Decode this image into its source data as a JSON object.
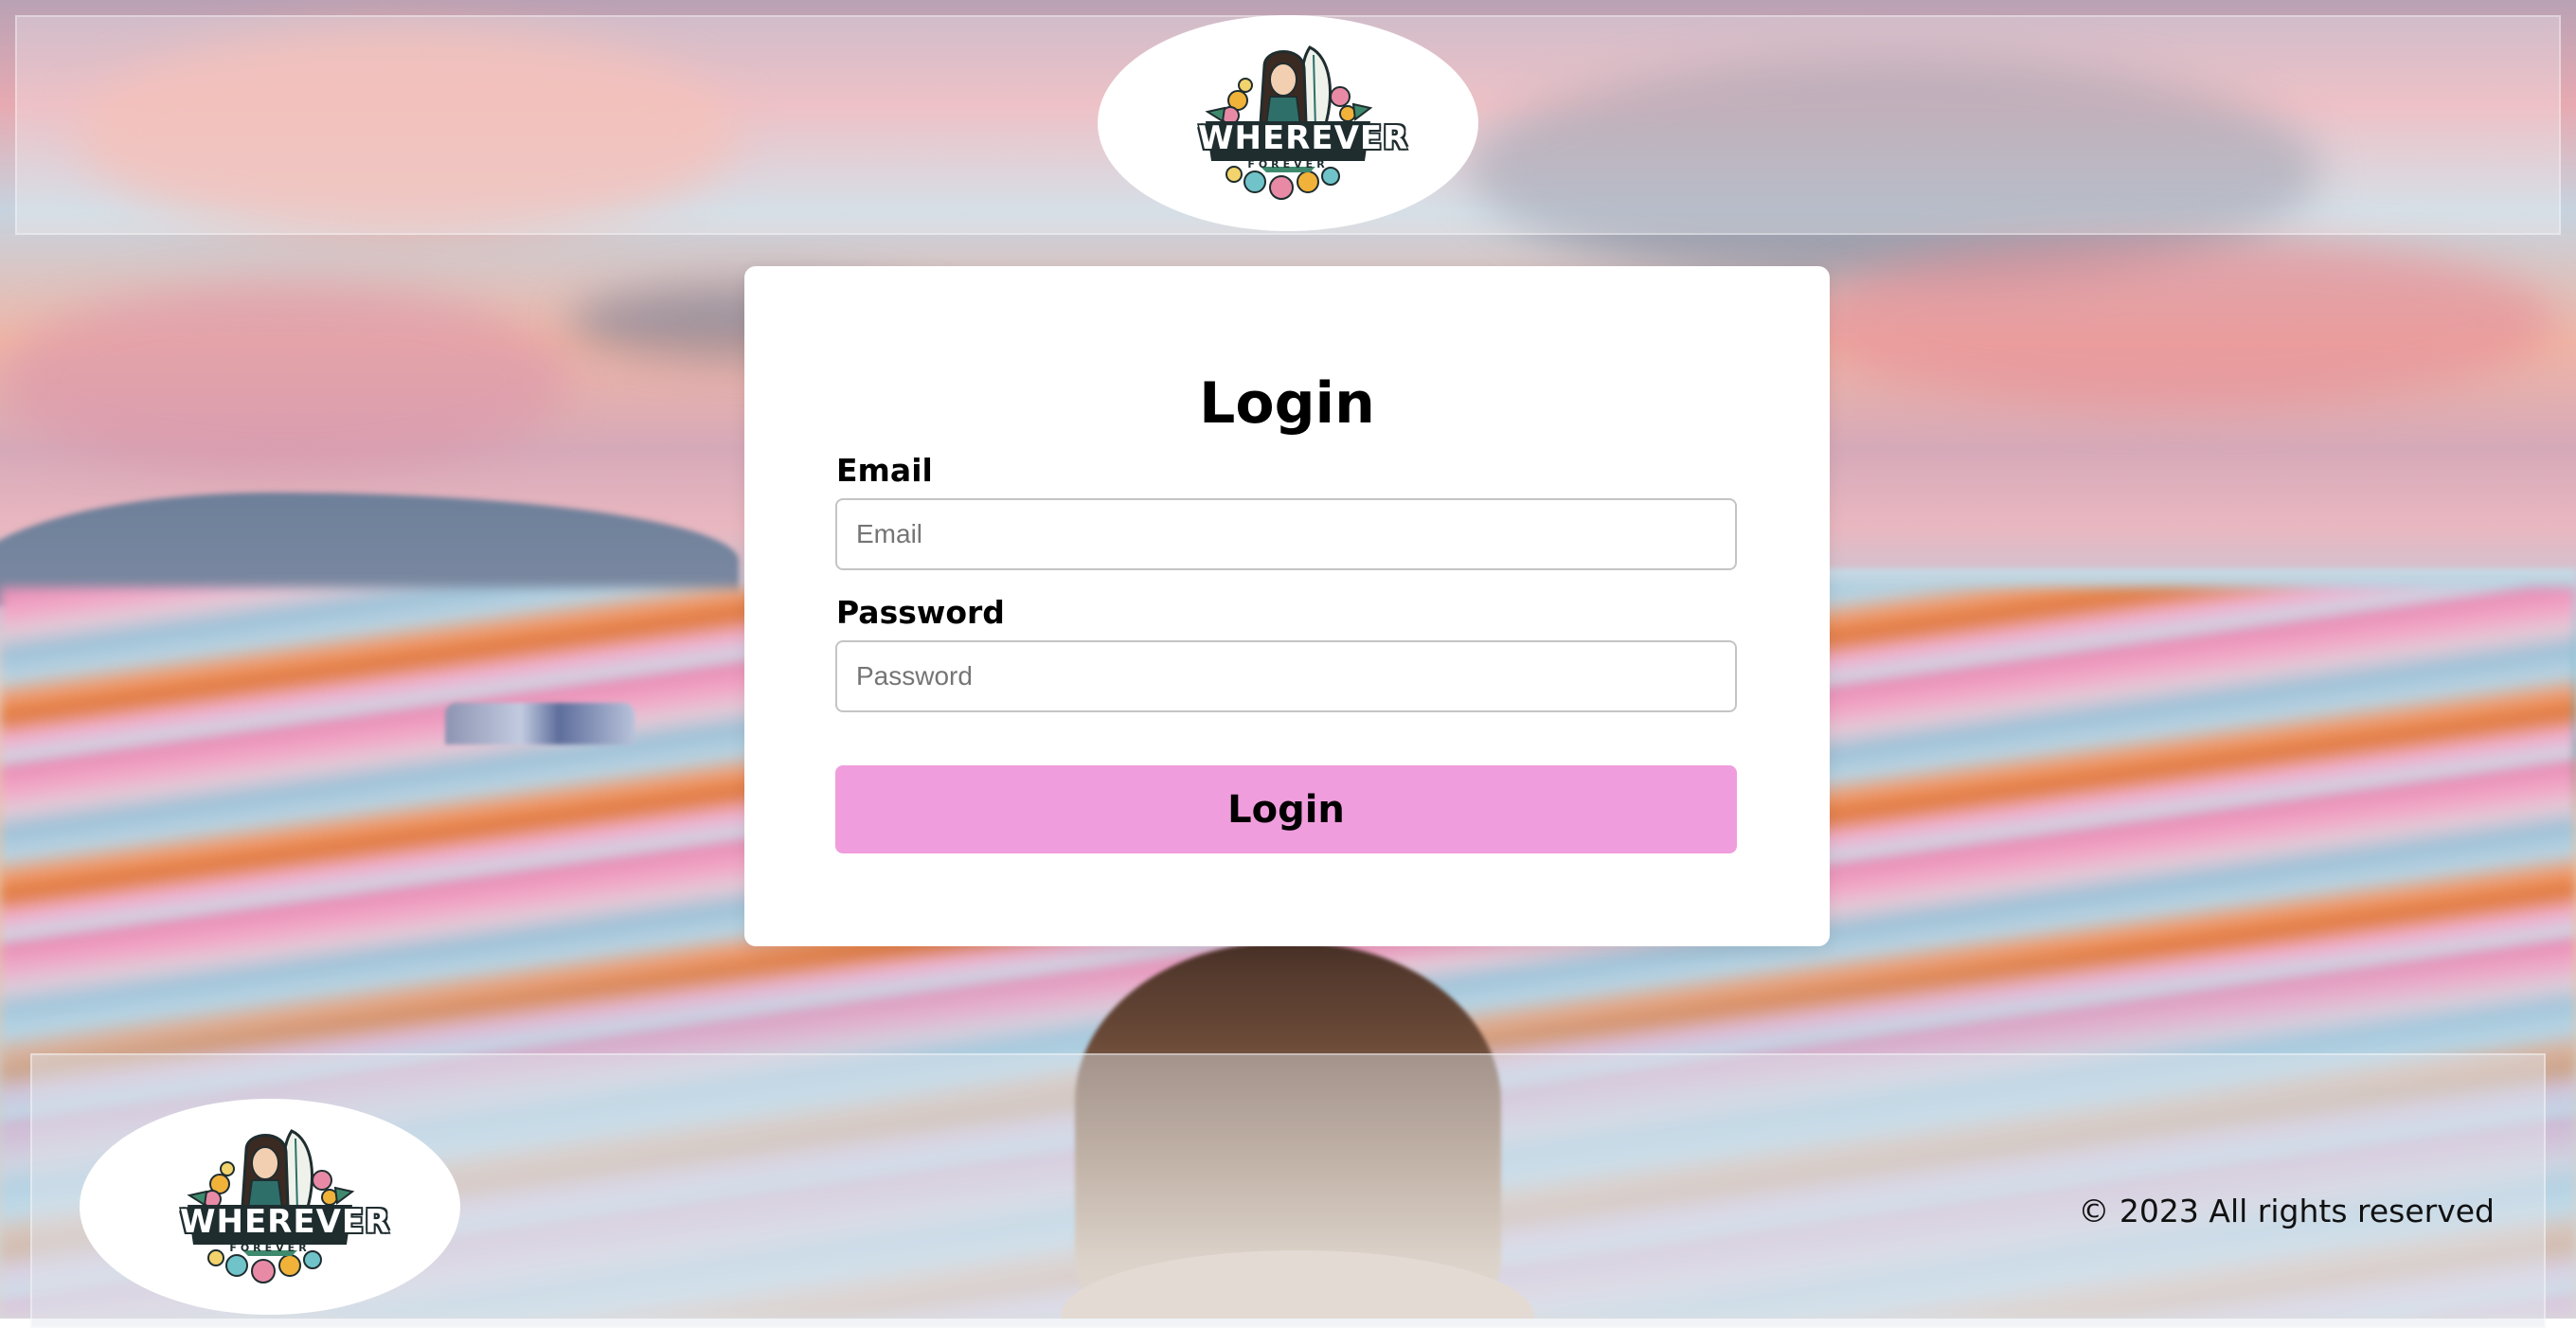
{
  "header": {
    "logo": {
      "brand_main": "WHEREVER",
      "brand_sub": "FOREVER"
    }
  },
  "login_form": {
    "title": "Login",
    "email": {
      "label": "Email",
      "placeholder": "Email",
      "value": ""
    },
    "password": {
      "label": "Password",
      "placeholder": "Password",
      "value": ""
    },
    "submit_label": "Login",
    "submit_color": "#f09ddd"
  },
  "footer": {
    "logo": {
      "brand_main": "WHEREVER",
      "brand_sub": "FOREVER"
    },
    "copyright": "© 2023 All rights reserved"
  },
  "icons": {
    "logo": "surfer-girl-badge-icon"
  }
}
